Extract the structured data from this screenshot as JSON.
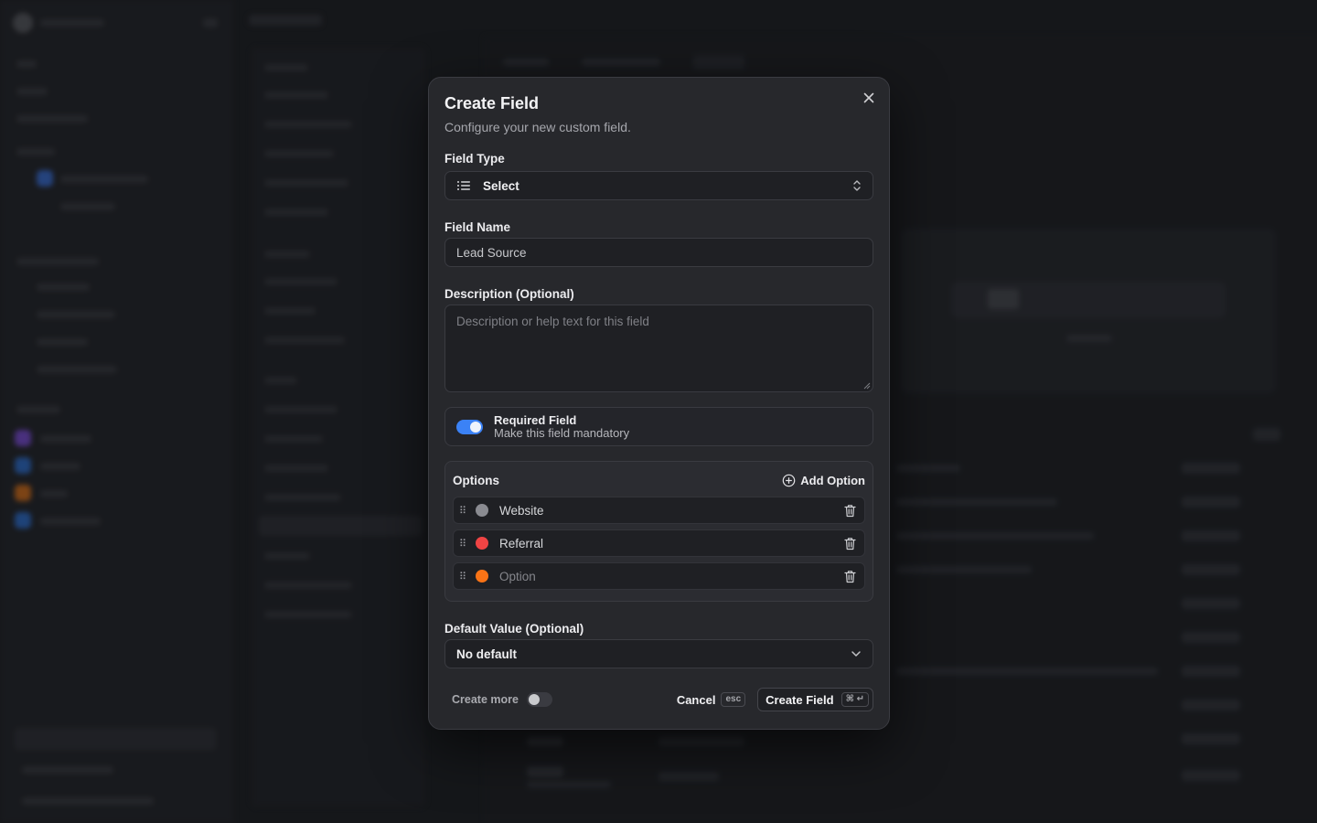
{
  "modal": {
    "title": "Create Field",
    "subtitle": "Configure your new custom field.",
    "close_icon": "close-icon"
  },
  "field_type": {
    "label": "Field Type",
    "value": "Select",
    "icon": "list-icon"
  },
  "field_name": {
    "label": "Field Name",
    "value": "Lead Source"
  },
  "description": {
    "label": "Description (Optional)",
    "placeholder": "Description or help text for this field"
  },
  "required": {
    "title": "Required Field",
    "subtitle": "Make this field mandatory",
    "enabled": true
  },
  "options": {
    "title": "Options",
    "add_label": "Add Option",
    "items": [
      {
        "label": "Website",
        "color": "#8a8b91",
        "placeholder": false
      },
      {
        "label": "Referral",
        "color": "#ef4444",
        "placeholder": false
      },
      {
        "label": "Option",
        "color": "#f97316",
        "placeholder": true
      }
    ]
  },
  "default_value": {
    "label": "Default Value (Optional)",
    "value": "No default"
  },
  "footer": {
    "create_more": "Create more",
    "create_more_enabled": false,
    "cancel": "Cancel",
    "cancel_kbd": "esc",
    "submit": "Create Field",
    "submit_kbd": "⌘ ↵"
  },
  "colors": {
    "accent": "#3b82f6",
    "modal_bg": "#27282c"
  }
}
